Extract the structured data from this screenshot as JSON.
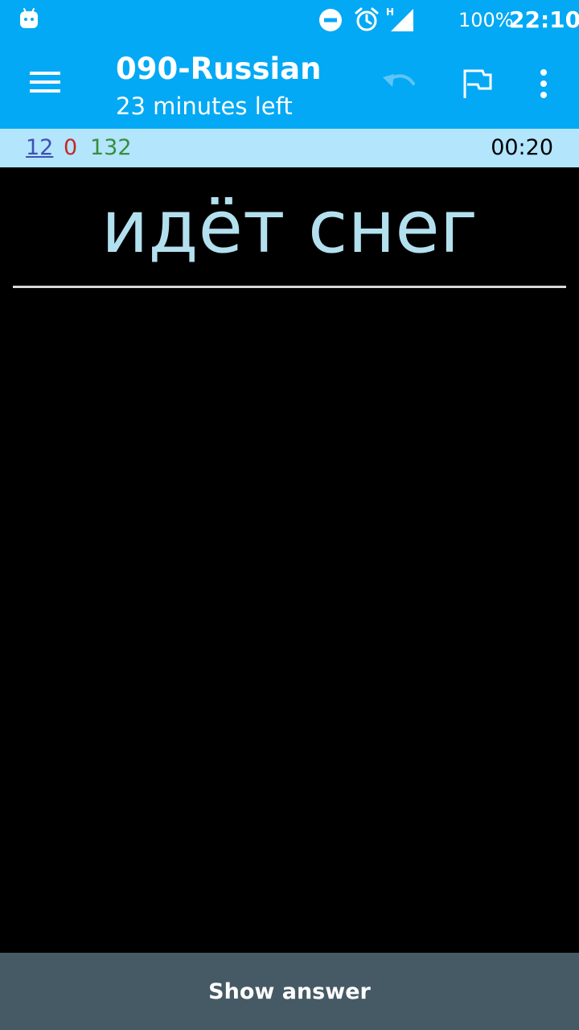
{
  "status_bar": {
    "battery": "100%",
    "time": "22:10",
    "network_type": "H",
    "icons": [
      "android-debug-icon",
      "do-not-disturb-icon",
      "alarm-icon",
      "cell-signal-icon"
    ]
  },
  "app_bar": {
    "title": "090-Russian",
    "subtitle": "23 minutes left",
    "icons": [
      "hamburger-menu-icon",
      "undo-icon",
      "flag-icon",
      "overflow-menu-icon"
    ]
  },
  "counts": {
    "new": "12",
    "learning": "0",
    "review": "132",
    "timer": "00:20"
  },
  "card": {
    "question": "идёт снег"
  },
  "answer_button": {
    "label": "Show answer"
  },
  "colors": {
    "primary": "#03a9f4",
    "counts_background": "#b3e5fc",
    "new_count": "#3f51b5",
    "learning_count": "#c62828",
    "review_count": "#388e3c",
    "card_text": "#b3e0ee",
    "answer_bar": "#455a64"
  }
}
